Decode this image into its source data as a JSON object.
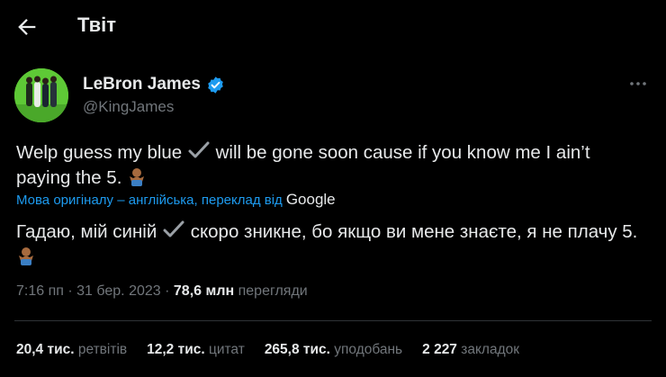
{
  "header": {
    "title": "Твіт"
  },
  "author": {
    "name": "LeBron James",
    "handle": "@KingJames"
  },
  "tweet": {
    "text_part1": "Welp guess my blue ",
    "text_part2": " will be gone soon cause if you know me I ain’t paying the 5. "
  },
  "translation": {
    "label": "Мова оригіналу – англійська, переклад від",
    "provider": "Google",
    "text_part1": "Гадаю, мій синій ",
    "text_part2": " скоро зникне, бо якщо ви мене знаєте, я не плачу 5. "
  },
  "meta": {
    "time": "7:16 пп",
    "date": "31 бер. 2023",
    "views_count": "78,6 млн",
    "views_label": "перегляди"
  },
  "stats": [
    {
      "value": "20,4 тис.",
      "label": "ретвітів"
    },
    {
      "value": "12,2 тис.",
      "label": "цитат"
    },
    {
      "value": "265,8 тис.",
      "label": "уподобань"
    },
    {
      "value": "2 227",
      "label": "закладок"
    }
  ],
  "icons": {
    "back": "arrow-left-icon",
    "verified": "verified-badge-icon",
    "more": "more-horizontal-icon",
    "checkmark": "checkmark-icon",
    "emoji": "person-shrugging-emoji"
  },
  "colors": {
    "accent": "#1d9bf0",
    "secondary_text": "#71767b",
    "background": "#000000"
  }
}
